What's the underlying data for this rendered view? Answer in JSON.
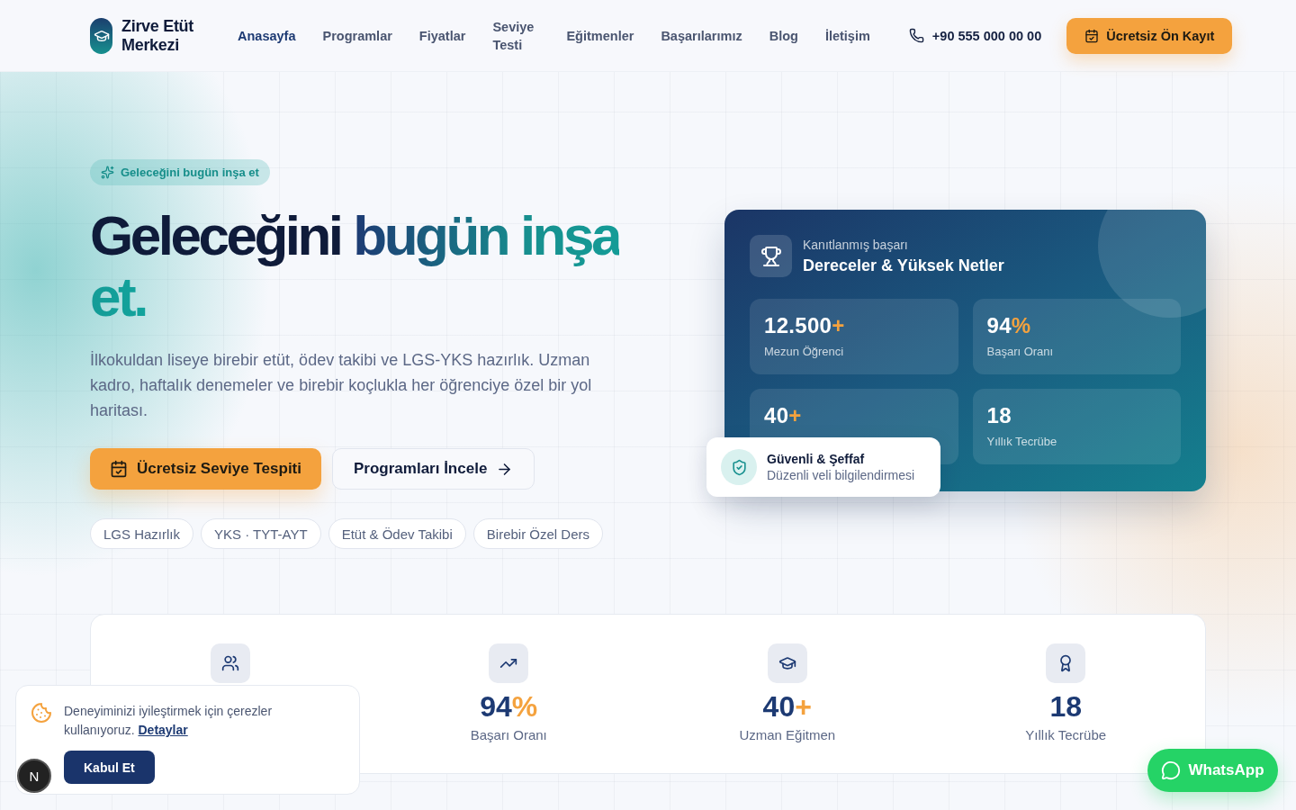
{
  "brand": {
    "name": "Zirve Etüt Merkezi"
  },
  "nav": [
    {
      "label": "Anasayfa",
      "selected": true
    },
    {
      "label": "Programlar",
      "selected": false
    },
    {
      "label": "Fiyatlar",
      "selected": false
    },
    {
      "label": "Seviye Testi",
      "selected": false
    },
    {
      "label": "Eğitmenler",
      "selected": false
    },
    {
      "label": "Başarılarımız",
      "selected": false
    },
    {
      "label": "Blog",
      "selected": false
    },
    {
      "label": "İletişim",
      "selected": false
    }
  ],
  "phone": "+90 555 000 00 00",
  "cta": "Ücretsiz Ön Kayıt",
  "hero": {
    "badge": "Geleceğini bugün inşa et",
    "title": "Geleceğini",
    "title_accent": "bugün inşa et.",
    "lead": "İlkokuldan liseye birebir etüt, ödev takibi ve LGS-YKS hazırlık. Uzman kadro, haftalık denemeler ve birebir koçlukla her öğrenciye özel bir yol haritası.",
    "primary": "Ücretsiz Seviye Tespiti",
    "secondary": "Programları İncele",
    "tags": [
      "LGS Hazırlık",
      "YKS · TYT-AYT",
      "Etüt & Ödev Takibi",
      "Birebir Özel Ders"
    ]
  },
  "achievements": {
    "eyebrow": "Kanıtlanmış başarı",
    "title": "Dereceler & Yüksek Netler",
    "stats": [
      {
        "value": "12.500",
        "suffix": "+",
        "label": "Mezun Öğrenci"
      },
      {
        "value": "94",
        "suffix": "%",
        "label": "Başarı Oranı"
      },
      {
        "value": "40",
        "suffix": "+"
      },
      {
        "value": "18",
        "label": "Yıllık Tecrübe"
      }
    ],
    "trust": {
      "title": "Güvenli & Şeffaf",
      "subtitle": "Düzenli veli bilgilendirmesi"
    }
  },
  "stats": [
    {
      "kind": "users"
    },
    {
      "kind": "trend",
      "value": "94",
      "suffix": "%",
      "label": "Başarı Oranı"
    },
    {
      "kind": "cap",
      "value": "40",
      "suffix": "+",
      "label": "Uzman Eğitmen"
    },
    {
      "kind": "award",
      "value": "18",
      "label": "Yıllık Tecrübe"
    }
  ],
  "cookie": {
    "text": "Deneyiminizi iyileştirmek için çerezler kullanıyoruz.",
    "link": "Detaylar",
    "accept": "Kabul Et"
  },
  "dev_badge": "N",
  "whatsapp": "WhatsApp"
}
